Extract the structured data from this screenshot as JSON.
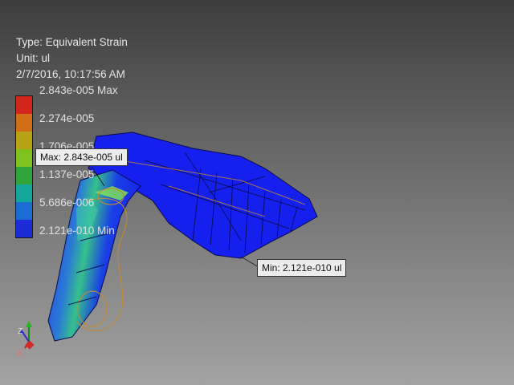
{
  "result": {
    "type_line": "Type: Equivalent Strain",
    "unit_line": "Unit: ul",
    "timestamp": "2/7/2016, 10:17:56 AM"
  },
  "legend": {
    "labels": [
      "2.843e-005 Max",
      "2.274e-005",
      "1.706e-005",
      "1.137e-005",
      "5.686e-006",
      "2.121e-010 Min"
    ],
    "colors": [
      "#d2261c",
      "#cf6e17",
      "#b7a314",
      "#7fc21e",
      "#2fa43a",
      "#13a79c",
      "#1b6bd2",
      "#1b2bd8"
    ]
  },
  "probes": {
    "max_label": "Max: 2.843e-005 ul",
    "min_label": "Min: 2.121e-010 ul"
  },
  "triad": {
    "z": "Z",
    "x": "X"
  },
  "colors": {
    "mesh": "#1a1aee",
    "edge": "#0b0b55",
    "outline": "#c68a2e"
  }
}
